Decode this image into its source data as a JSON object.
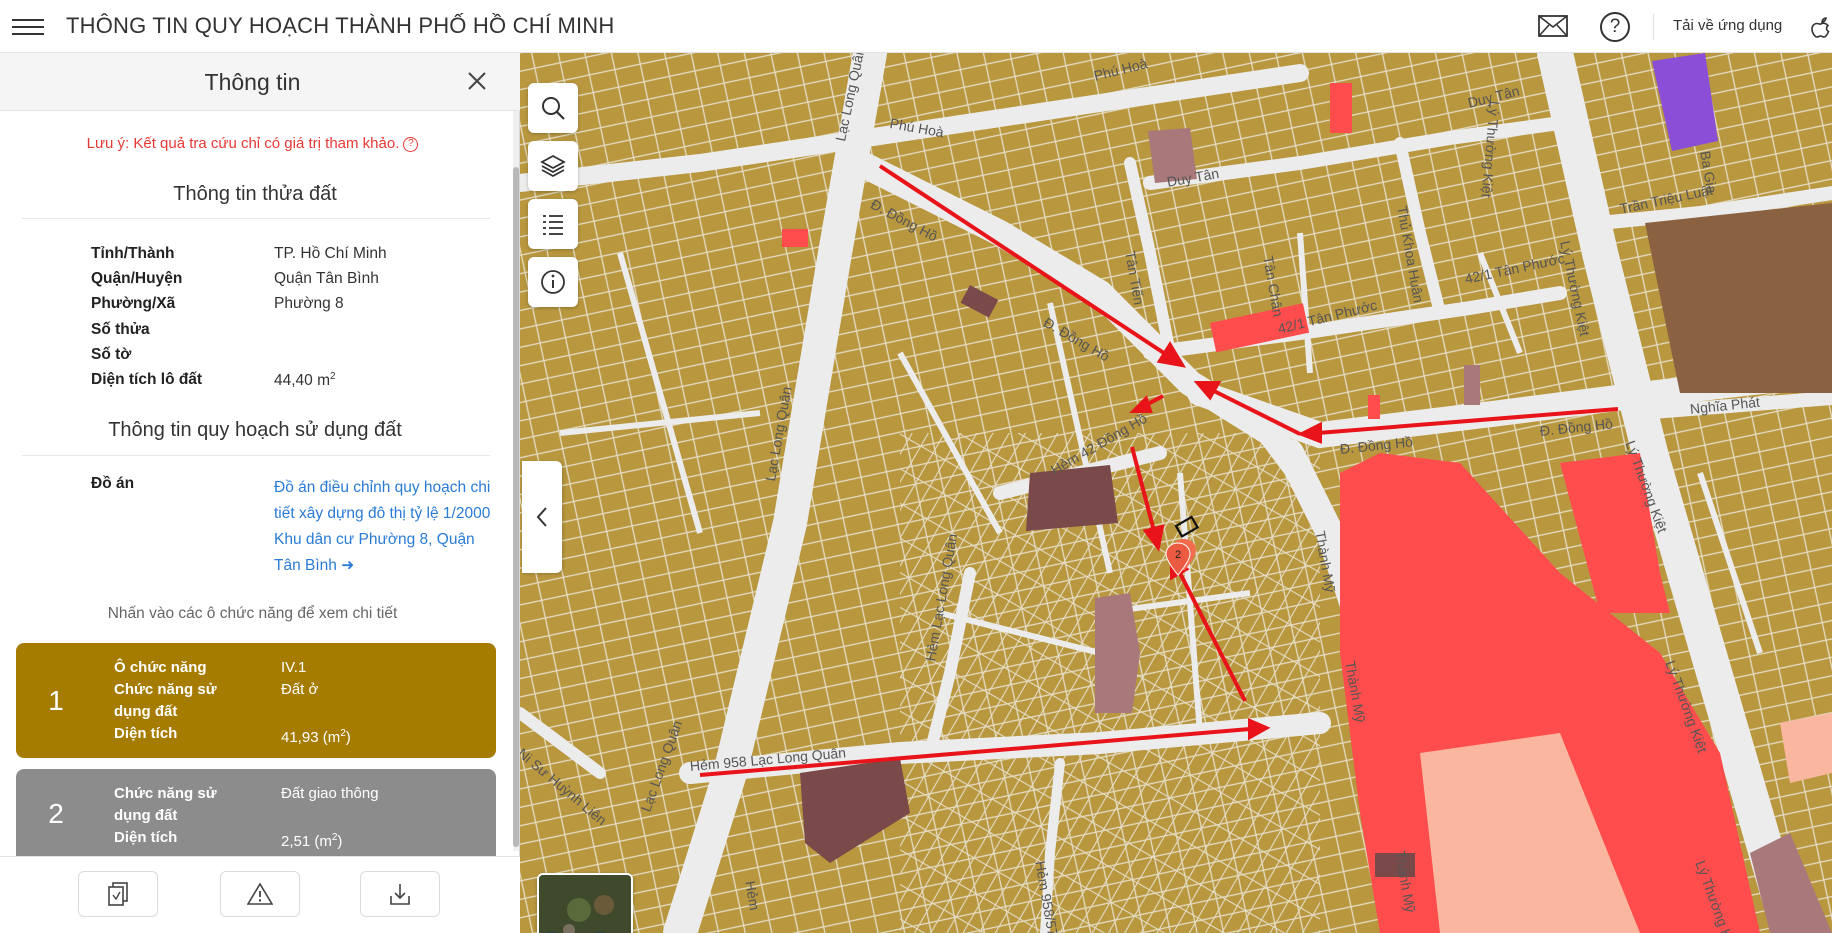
{
  "header": {
    "title": "THÔNG TIN QUY HOẠCH THÀNH PHỐ HỒ CHÍ MINH",
    "download_label": "Tải về ứng dụng",
    "help_glyph": "?"
  },
  "panel": {
    "title": "Thông tin",
    "note": "Lưu ý: Kết quả tra cứu chỉ có giá trị tham khảo.",
    "note_glyph": "?",
    "parcel_section_title": "Thông tin thửa đất",
    "parcel": {
      "province_label": "Tỉnh/Thành",
      "province_value": "TP. Hồ Chí Minh",
      "district_label": "Quận/Huyện",
      "district_value": "Quận Tân Bình",
      "ward_label": "Phường/Xã",
      "ward_value": "Phường 8",
      "parcel_no_label": "Số thửa",
      "parcel_no_value": "",
      "sheet_no_label": "Số tờ",
      "sheet_no_value": "",
      "area_label": "Diện tích lô đất",
      "area_value": "44,40 m",
      "area_unit_sup": "2"
    },
    "planning_section_title": "Thông tin quy hoạch sử dụng đất",
    "plan_label": "Đồ án",
    "plan_link": "Đồ án điều chỉnh quy hoạch chi tiết xây dựng đô thị tỷ lệ 1/2000 Khu dân cư Phường 8, Quận Tân Bình",
    "hint": "Nhấn vào các ô chức năng để xem chi tiết",
    "cards": [
      {
        "number": "1",
        "color": "#a57c00",
        "cell_label": "Ô chức năng",
        "cell_value": "IV.1",
        "function_label": "Chức năng sử dụng đất",
        "function_value": "Đất ở",
        "area_label": "Diện tích",
        "area_value": "41,93 (m",
        "area_sup": "2",
        "area_close": ")"
      },
      {
        "number": "2",
        "color": "#8c8c8c",
        "function_label": "Chức năng sử dụng đất",
        "function_value": "Đất giao thông",
        "area_label": "Diện tích",
        "area_value": "2,51 (m",
        "area_sup": "2",
        "area_close": ")"
      }
    ]
  },
  "map": {
    "marker_number": "2",
    "colors": {
      "residential": "#b8973f",
      "commercial": "#ff4d4d",
      "light_commercial": "#fbb6a0",
      "institutional": "#7a4a4a",
      "mauve": "#a8787a",
      "purple": "#8a4fd6",
      "brown_large": "#8a6242",
      "road": "#ececec",
      "arrow": "#e8141a"
    },
    "street_labels": [
      "Phú Hoà",
      "Phú Hoà",
      "Lạc Long Quân",
      "Đ. Đồng Hồ",
      "Duy Tân",
      "Duy Tân",
      "Lý Thường Kiệt",
      "Ba Gia",
      "Trần Triệu Luật",
      "Thủ Khoa Huân",
      "Tân Tiến",
      "Đ. Đồng Hồ",
      "42/1 Tân Phước",
      "Lạc Long Quân",
      "42/1 Tân Phước",
      "Tân Chân",
      "Lý Thường Kiệt",
      "Nghĩa Phát",
      "Đ. Đồng Hồ",
      "Đ. Đồng Hồ",
      "Hẻm 42 Đồng Hồ",
      "Thành Mỹ",
      "Lý Thường Kiệt",
      "Hẻm Lạc Long Quân",
      "Thành Mỹ",
      "Lý Thường Kiệt",
      "Lạc Long Quân",
      "Hẻm 958 Lạc Long Quân",
      "Ni Sư Huỳnh Liên",
      "Hẻm 958/57",
      "Thành Mỹ",
      "Lý Thường Kiệt",
      "Hẻm"
    ]
  }
}
